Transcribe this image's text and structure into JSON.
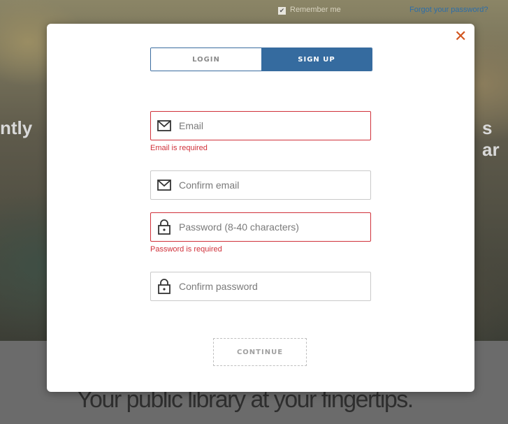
{
  "background": {
    "remember_me": "Remember me",
    "forgot_password": "Forgot your password?",
    "hero_left": "ntly",
    "hero_right": "s ar",
    "tagline": "Your public library at your fingertips."
  },
  "modal": {
    "close_glyph": "✕",
    "tabs": [
      {
        "label": "LOGIN",
        "active": false
      },
      {
        "label": "SIGN UP",
        "active": true
      }
    ],
    "fields": {
      "email": {
        "placeholder": "Email",
        "value": "",
        "error": "Email is required",
        "icon": "envelope-icon"
      },
      "confirm_email": {
        "placeholder": "Confirm email",
        "value": "",
        "icon": "envelope-icon"
      },
      "password": {
        "placeholder": "Password (8-40 characters)",
        "value": "",
        "error": "Password is required",
        "icon": "lock-icon"
      },
      "confirm_password": {
        "placeholder": "Confirm password",
        "value": "",
        "icon": "lock-icon"
      }
    },
    "continue_label": "CONTINUE"
  },
  "colors": {
    "accent": "#356b9f",
    "error": "#d0313a",
    "close": "#d2561f"
  }
}
